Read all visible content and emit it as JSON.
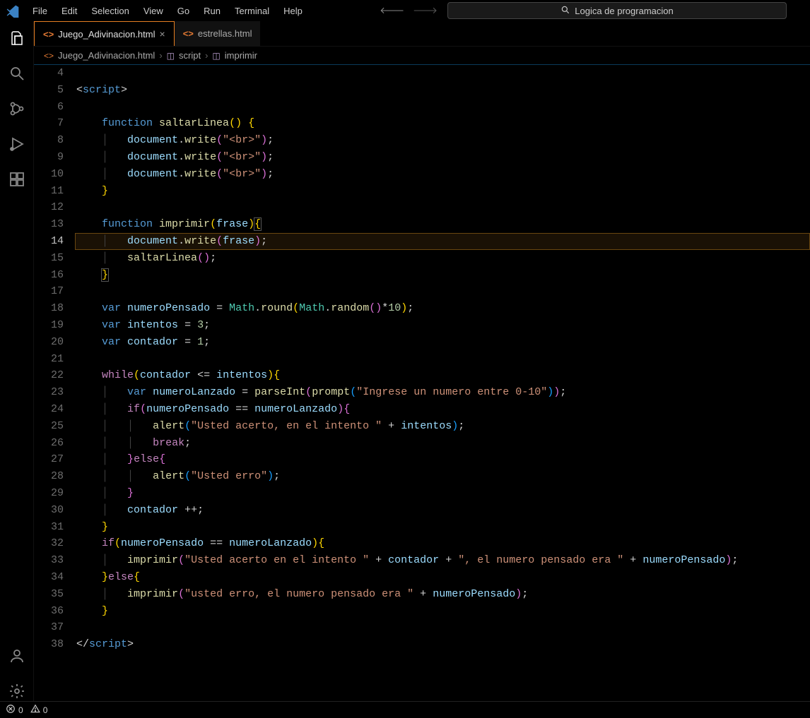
{
  "menu": {
    "items": [
      "File",
      "Edit",
      "Selection",
      "View",
      "Go",
      "Run",
      "Terminal",
      "Help"
    ]
  },
  "search": {
    "text": "Logica de programacion"
  },
  "tabs": [
    {
      "label": "Juego_Adivinacion.html",
      "active": true
    },
    {
      "label": "estrellas.html",
      "active": false
    }
  ],
  "breadcrumbs": {
    "file": "Juego_Adivinacion.html",
    "scope1": "script",
    "scope2": "imprimir"
  },
  "gutter_start": 4,
  "gutter_end": 38,
  "current_line": 14,
  "code_lines": [
    {
      "n": 4,
      "html": ""
    },
    {
      "n": 5,
      "html": "<span class='t-punc'>&lt;</span><span class='t-tag'>script</span><span class='t-punc'>&gt;</span>"
    },
    {
      "n": 6,
      "html": ""
    },
    {
      "n": 7,
      "html": "    <span class='t-kw'>function</span> <span class='t-fn'>saltarLinea</span><span class='t-par'>()</span> <span class='t-par'>{</span>"
    },
    {
      "n": 8,
      "html": "    <span class='guide'>│</span>   <span class='t-obj'>document</span><span class='t-punc'>.</span><span class='t-fn'>write</span><span class='t-par2'>(</span><span class='t-str'>\"&lt;br&gt;\"</span><span class='t-par2'>)</span><span class='t-punc'>;</span>"
    },
    {
      "n": 9,
      "html": "    <span class='guide'>│</span>   <span class='t-obj'>document</span><span class='t-punc'>.</span><span class='t-fn'>write</span><span class='t-par2'>(</span><span class='t-str'>\"&lt;br&gt;\"</span><span class='t-par2'>)</span><span class='t-punc'>;</span>"
    },
    {
      "n": 10,
      "html": "    <span class='guide'>│</span>   <span class='t-obj'>document</span><span class='t-punc'>.</span><span class='t-fn'>write</span><span class='t-par2'>(</span><span class='t-str'>\"&lt;br&gt;\"</span><span class='t-par2'>)</span><span class='t-punc'>;</span>"
    },
    {
      "n": 11,
      "html": "    <span class='t-par'>}</span>"
    },
    {
      "n": 12,
      "html": ""
    },
    {
      "n": 13,
      "html": "    <span class='t-kw'>function</span> <span class='t-fn'>imprimir</span><span class='t-par'>(</span><span class='t-var'>frase</span><span class='t-par'>)</span><span class='t-par t-box'>{</span>"
    },
    {
      "n": 14,
      "html": "    <span class='guide'>│</span>   <span class='t-obj'>document</span><span class='t-punc'>.</span><span class='t-fn'>write</span><span class='t-par2'>(</span><span class='t-var'>frase</span><span class='t-par2'>)</span><span class='t-punc'>;</span>",
      "hl": true
    },
    {
      "n": 15,
      "html": "    <span class='guide'>│</span>   <span class='t-fn'>saltarLinea</span><span class='t-par2'>()</span><span class='t-punc'>;</span>"
    },
    {
      "n": 16,
      "html": "    <span class='t-par t-box'>}</span>"
    },
    {
      "n": 17,
      "html": ""
    },
    {
      "n": 18,
      "html": "    <span class='t-kw'>var</span> <span class='t-var'>numeroPensado</span> <span class='t-op'>=</span> <span class='t-cls'>Math</span><span class='t-punc'>.</span><span class='t-fn'>round</span><span class='t-par'>(</span><span class='t-cls'>Math</span><span class='t-punc'>.</span><span class='t-fn'>random</span><span class='t-par2'>()</span><span class='t-op'>*</span><span class='t-num'>10</span><span class='t-par'>)</span><span class='t-punc'>;</span>"
    },
    {
      "n": 19,
      "html": "    <span class='t-kw'>var</span> <span class='t-var'>intentos</span> <span class='t-op'>=</span> <span class='t-num'>3</span><span class='t-punc'>;</span>"
    },
    {
      "n": 20,
      "html": "    <span class='t-kw'>var</span> <span class='t-var'>contador</span> <span class='t-op'>=</span> <span class='t-num'>1</span><span class='t-punc'>;</span>"
    },
    {
      "n": 21,
      "html": ""
    },
    {
      "n": 22,
      "html": "    <span class='t-ctrl'>while</span><span class='t-par'>(</span><span class='t-var'>contador</span> <span class='t-op'>&lt;=</span> <span class='t-var'>intentos</span><span class='t-par'>){</span>"
    },
    {
      "n": 23,
      "html": "    <span class='guide'>│</span>   <span class='t-kw'>var</span> <span class='t-var'>numeroLanzado</span> <span class='t-op'>=</span> <span class='t-fn'>parseInt</span><span class='t-par2'>(</span><span class='t-fn'>prompt</span><span class='t-par3'>(</span><span class='t-str'>\"Ingrese un numero entre 0-10\"</span><span class='t-par3'>)</span><span class='t-par2'>)</span><span class='t-punc'>;</span>"
    },
    {
      "n": 24,
      "html": "    <span class='guide'>│</span>   <span class='t-ctrl'>if</span><span class='t-par2'>(</span><span class='t-var'>numeroPensado</span> <span class='t-op'>==</span> <span class='t-var'>numeroLanzado</span><span class='t-par2'>){</span>"
    },
    {
      "n": 25,
      "html": "    <span class='guide'>│</span>   <span class='guide'>│</span>   <span class='t-fn'>alert</span><span class='t-par3'>(</span><span class='t-str'>\"Usted acerto, en el intento \"</span> <span class='t-op'>+</span> <span class='t-var'>intentos</span><span class='t-par3'>)</span><span class='t-punc'>;</span>"
    },
    {
      "n": 26,
      "html": "    <span class='guide'>│</span>   <span class='guide'>│</span>   <span class='t-ctrl'>break</span><span class='t-punc'>;</span>"
    },
    {
      "n": 27,
      "html": "    <span class='guide'>│</span>   <span class='t-par2'>}</span><span class='t-ctrl'>else</span><span class='t-par2'>{</span>"
    },
    {
      "n": 28,
      "html": "    <span class='guide'>│</span>   <span class='guide'>│</span>   <span class='t-fn'>alert</span><span class='t-par3'>(</span><span class='t-str'>\"Usted erro\"</span><span class='t-par3'>)</span><span class='t-punc'>;</span>"
    },
    {
      "n": 29,
      "html": "    <span class='guide'>│</span>   <span class='t-par2'>}</span>"
    },
    {
      "n": 30,
      "html": "    <span class='guide'>│</span>   <span class='t-var'>contador</span> <span class='t-op'>++</span><span class='t-punc'>;</span>"
    },
    {
      "n": 31,
      "html": "    <span class='t-par'>}</span>"
    },
    {
      "n": 32,
      "html": "    <span class='t-ctrl'>if</span><span class='t-par'>(</span><span class='t-var'>numeroPensado</span> <span class='t-op'>==</span> <span class='t-var'>numeroLanzado</span><span class='t-par'>){</span>"
    },
    {
      "n": 33,
      "html": "    <span class='guide'>│</span>   <span class='t-fn'>imprimir</span><span class='t-par2'>(</span><span class='t-str'>\"Usted acerto en el intento \"</span> <span class='t-op'>+</span> <span class='t-var'>contador</span> <span class='t-op'>+</span> <span class='t-str'>\", el numero pensado era \"</span> <span class='t-op'>+</span> <span class='t-var'>numeroPensado</span><span class='t-par2'>)</span><span class='t-punc'>;</span>"
    },
    {
      "n": 34,
      "html": "    <span class='t-par'>}</span><span class='t-ctrl'>else</span><span class='t-par'>{</span>"
    },
    {
      "n": 35,
      "html": "    <span class='guide'>│</span>   <span class='t-fn'>imprimir</span><span class='t-par2'>(</span><span class='t-str'>\"usted erro, el numero pensado era \"</span> <span class='t-op'>+</span> <span class='t-var'>numeroPensado</span><span class='t-par2'>)</span><span class='t-punc'>;</span>"
    },
    {
      "n": 36,
      "html": "    <span class='t-par'>}</span>"
    },
    {
      "n": 37,
      "html": ""
    },
    {
      "n": 38,
      "html": "<span class='t-punc'>&lt;/</span><span class='t-tag'>script</span><span class='t-punc'>&gt;</span>"
    }
  ],
  "statusbar": {
    "errors": "0",
    "warnings": "0"
  }
}
